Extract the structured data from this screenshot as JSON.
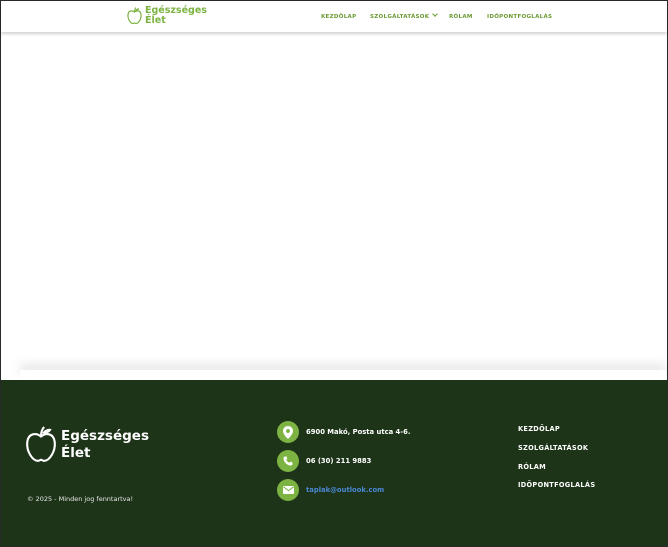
{
  "brand": {
    "name": "Egészséges Élet",
    "line1": "Egészséges",
    "line2": "Élet"
  },
  "colors": {
    "accent": "#7cb342",
    "footer_bg": "#1d3418",
    "link": "#4a86d4"
  },
  "nav": {
    "items": [
      {
        "label": "KEZDŐLAP"
      },
      {
        "label": "SZOLGÁLTATÁSOK",
        "has_dropdown": true
      },
      {
        "label": "RÓLAM"
      },
      {
        "label": "IDŐPONTFOGLALÁS"
      }
    ]
  },
  "footer": {
    "brand_line1": "Egészséges",
    "brand_line2": "Élet",
    "copyright": "© 2025 - Minden jog fenntartva!",
    "contact": {
      "address": "6900 Makó, Posta utca 4-6.",
      "phone": "06 (30) 211 9883",
      "email": "taplak@outlook.com"
    },
    "nav": [
      {
        "label": "KEZDŐLAP"
      },
      {
        "label": "SZOLGÁLTATÁSOK"
      },
      {
        "label": "RÓLAM"
      },
      {
        "label": "IDŐPONTFOGLALÁS"
      }
    ]
  },
  "icons": [
    "apple-icon",
    "location-pin-icon",
    "phone-icon",
    "envelope-icon",
    "chevron-down-icon"
  ]
}
